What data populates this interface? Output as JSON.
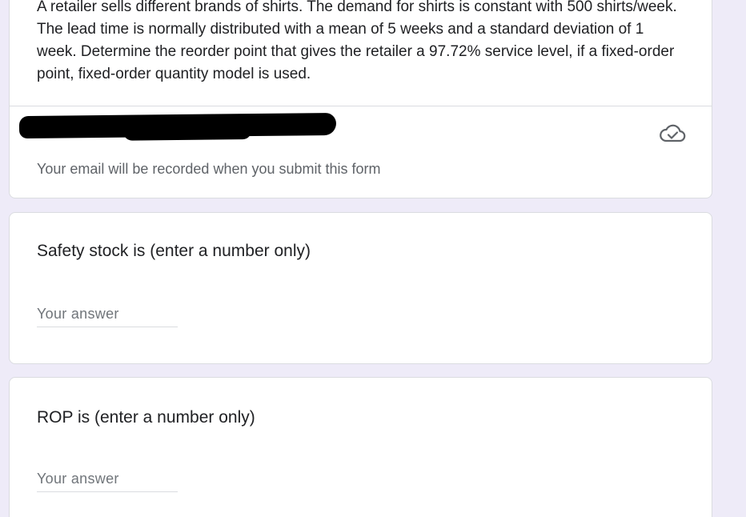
{
  "header": {
    "description": "A retailer sells different brands of shirts. The demand for shirts is constant with 500 shirts/week. The lead time is normally distributed with a mean of 5 weeks and a standard deviation of 1 week. Determine the reorder point that gives the retailer a 97.72% service level, if a fixed-order point, fixed-order quantity model is used.",
    "email_note": "Your email will be recorded when you submit this form",
    "cloud_icon": "cloud-saved-icon"
  },
  "questions": [
    {
      "title": "Safety stock is (enter a number only)",
      "placeholder": "Your answer"
    },
    {
      "title": "ROP is (enter a number only)",
      "placeholder": "Your answer"
    }
  ],
  "colors": {
    "background": "#eeebf8",
    "card": "#ffffff",
    "text": "#202124",
    "muted": "#5f6368",
    "border": "#dadce0"
  }
}
